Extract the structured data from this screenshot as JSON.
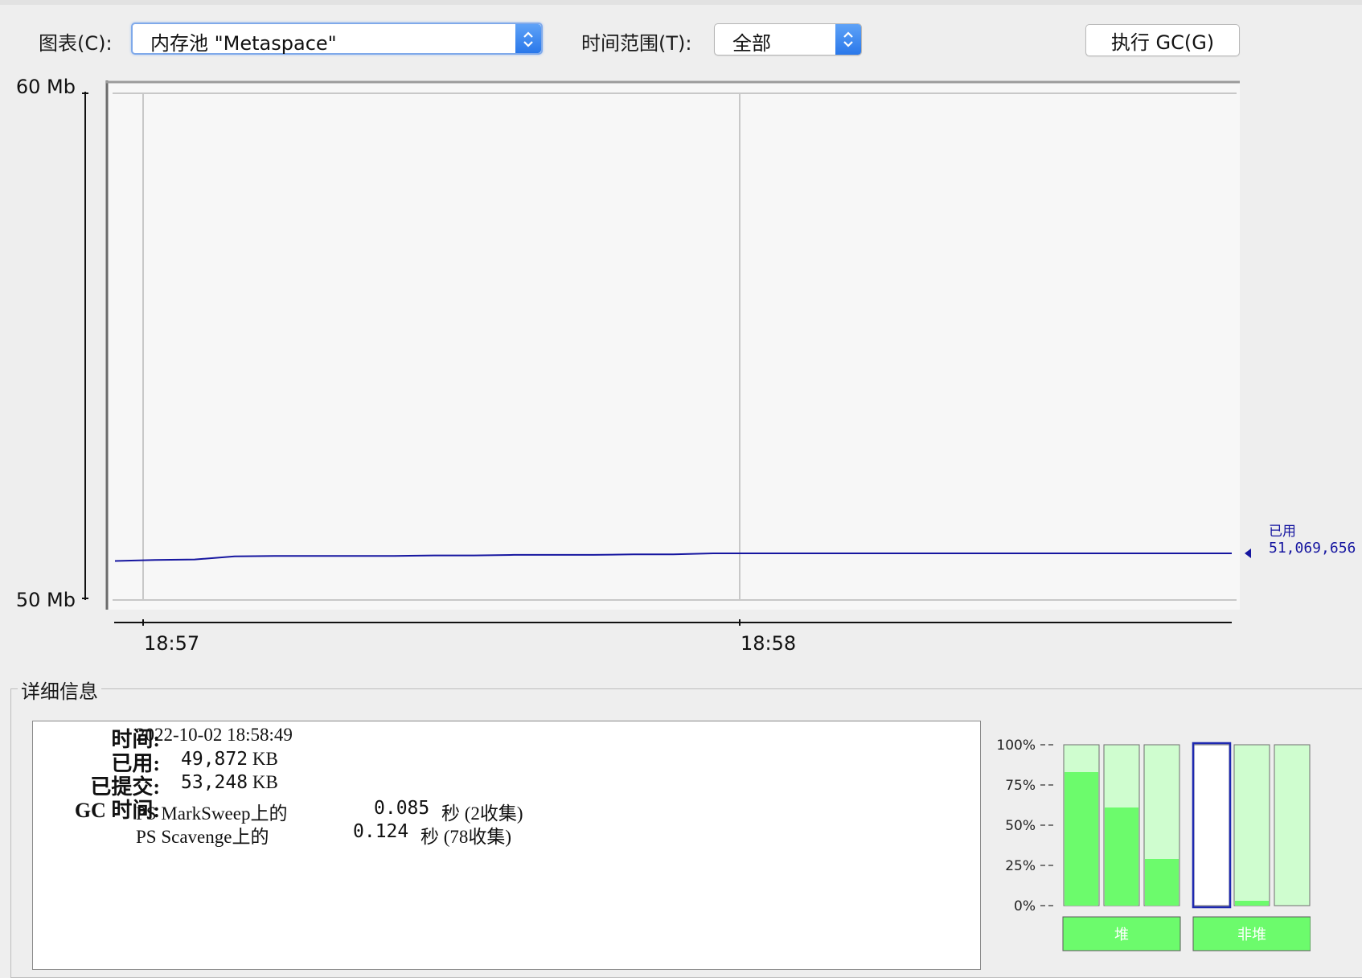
{
  "toolbar": {
    "chart_label": "图表(C):",
    "chart_select_value": "内存池 \"Metaspace\"",
    "range_label": "时间范围(T):",
    "range_select_value": "全部",
    "gc_button_label": "执行 GC(G)"
  },
  "chart_data": {
    "type": "line",
    "y_axis_labels": [
      "60 Mb",
      "50 Mb"
    ],
    "ylim_mb": [
      50,
      60
    ],
    "x_tick_labels": [
      "18:57",
      "18:58"
    ],
    "grid": true,
    "series": [
      {
        "name": "已用",
        "color": "#1616a0",
        "points": [
          [
            0,
            50.77
          ],
          [
            5,
            50.79
          ],
          [
            10,
            50.8
          ],
          [
            15,
            50.86
          ],
          [
            20,
            50.87
          ],
          [
            25,
            50.87
          ],
          [
            30,
            50.87
          ],
          [
            35,
            50.87
          ],
          [
            40,
            50.88
          ],
          [
            45,
            50.88
          ],
          [
            50,
            50.89
          ],
          [
            55,
            50.89
          ],
          [
            60,
            50.89
          ],
          [
            65,
            50.9
          ],
          [
            70,
            50.9
          ],
          [
            75,
            50.92
          ],
          [
            80,
            50.92
          ],
          [
            85,
            50.92
          ],
          [
            90,
            50.92
          ],
          [
            95,
            50.92
          ],
          [
            100,
            50.92
          ],
          [
            105,
            50.92
          ],
          [
            110,
            50.92
          ],
          [
            115,
            50.92
          ],
          [
            120,
            50.92
          ],
          [
            125,
            50.92
          ],
          [
            130,
            50.92
          ],
          [
            135,
            50.92
          ],
          [
            140,
            50.92
          ]
        ]
      }
    ],
    "current_label": "已用",
    "current_value": "51,069,656"
  },
  "details": {
    "title": "详细信息",
    "time_label": "时间:",
    "time_value": "2022-10-02 18:58:49",
    "used_label": "已用:",
    "used_value": "49,872",
    "used_unit": "KB",
    "committed_label": "已提交:",
    "committed_value": "53,248",
    "committed_unit": "KB",
    "gc_label": "GC 时间:",
    "gc_rows": [
      {
        "name": "PS MarkSweep上的",
        "time": "0.085",
        "unit": "秒",
        "count": "(2收集)"
      },
      {
        "name": "PS Scavenge上的",
        "time": "0.124",
        "unit": "秒",
        "count": "(78收集)"
      }
    ]
  },
  "pool_bars": {
    "scale_labels": [
      "100%",
      "75%",
      "50%",
      "25%",
      "0%"
    ],
    "heap_label": "堆",
    "nonheap_label": "非堆",
    "heap": [
      {
        "used": 0.83,
        "committed": 1.0
      },
      {
        "used": 0.61,
        "committed": 1.0
      },
      {
        "used": 0.29,
        "committed": 1.0
      }
    ],
    "nonheap": [
      {
        "used": 0.0,
        "committed": 0.0,
        "selected": true
      },
      {
        "used": 0.03,
        "committed": 1.0
      },
      {
        "used": 0.0,
        "committed": 1.0
      }
    ],
    "colors": {
      "used": "#6cfb6c",
      "committed": "#cffdcf",
      "selected": "#1d28b0"
    }
  }
}
